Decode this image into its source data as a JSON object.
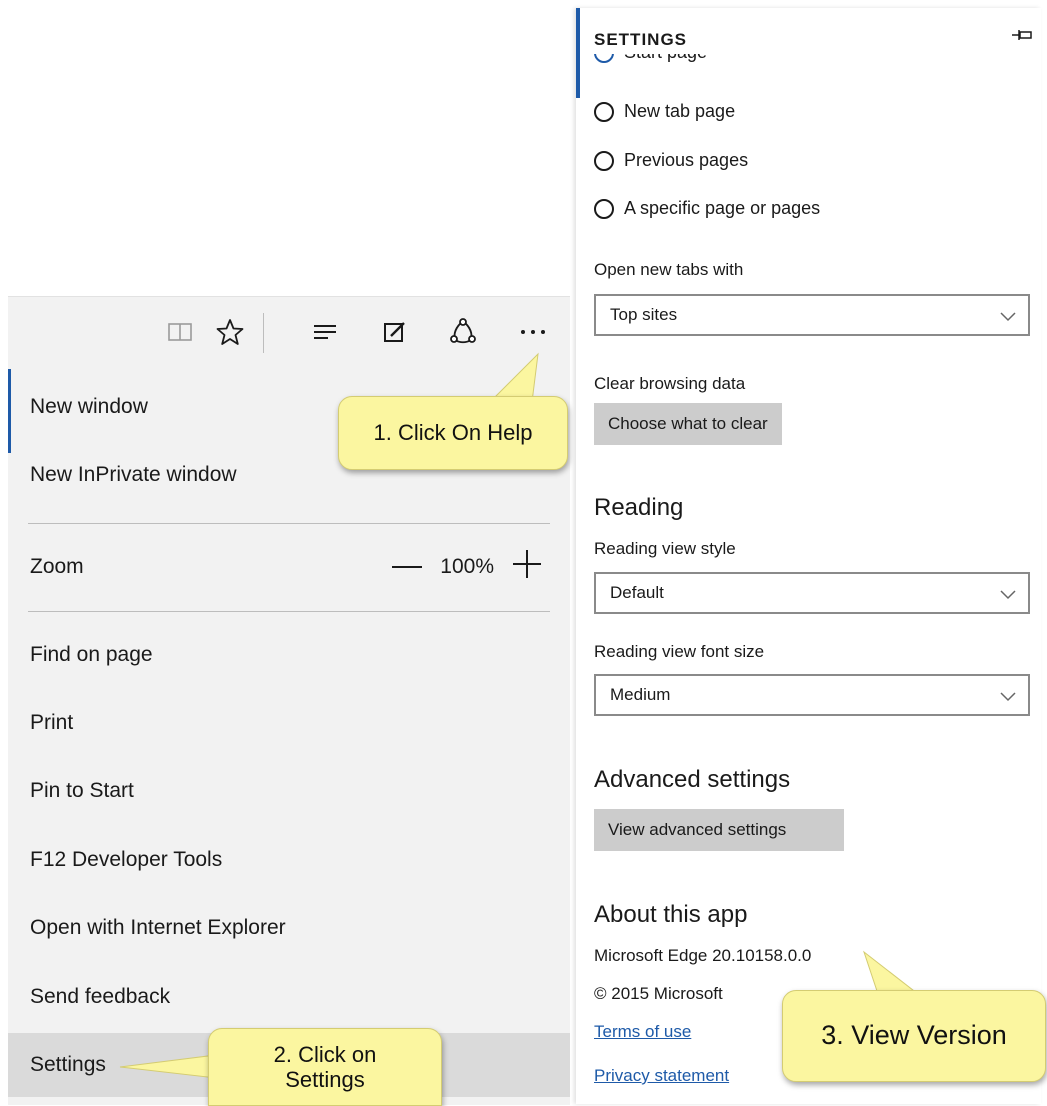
{
  "menu": {
    "items": [
      {
        "label": "New window"
      },
      {
        "label": "New InPrivate window"
      },
      {
        "label": "Zoom"
      },
      {
        "label": "Find on page"
      },
      {
        "label": "Print"
      },
      {
        "label": "Pin to Start"
      },
      {
        "label": "F12 Developer Tools"
      },
      {
        "label": "Open with Internet Explorer"
      },
      {
        "label": "Send feedback"
      },
      {
        "label": "Settings"
      }
    ],
    "zoom_value": "100%",
    "toolbar_icons": [
      "reading-view-icon",
      "favorites-star-icon",
      "hub-icon",
      "web-note-icon",
      "share-icon",
      "more-actions-icon"
    ]
  },
  "settings": {
    "title": "SETTINGS",
    "open_with_options": [
      "Start page",
      "New tab page",
      "Previous pages",
      "A specific page or pages"
    ],
    "open_new_tabs_label": "Open new tabs with",
    "open_new_tabs_value": "Top sites",
    "clear_label": "Clear browsing data",
    "clear_button": "Choose what to clear",
    "reading_heading": "Reading",
    "reading_style_label": "Reading view style",
    "reading_style_value": "Default",
    "reading_font_label": "Reading view font size",
    "reading_font_value": "Medium",
    "advanced_heading": "Advanced settings",
    "advanced_button": "View advanced settings",
    "about_heading": "About this app",
    "version": "Microsoft Edge 20.10158.0.0",
    "copyright": "© 2015 Microsoft",
    "terms_link": "Terms of use",
    "privacy_link": "Privacy statement"
  },
  "callouts": {
    "step1": "1. Click On Help",
    "step2_line1": "2. Click on",
    "step2_line2": "Settings",
    "step3": "3. View Version"
  },
  "colors": {
    "accent": "#1e5aa8",
    "callout": "#fbf6a0",
    "menu_bg": "#f2f2f2"
  }
}
